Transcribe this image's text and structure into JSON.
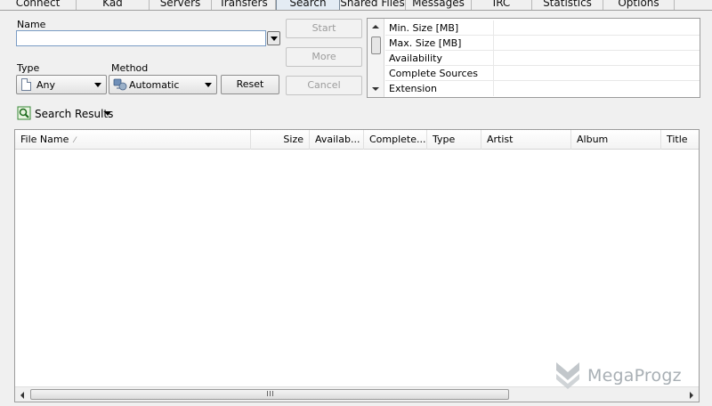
{
  "tabs": [
    {
      "label": "Connect",
      "active": false
    },
    {
      "label": "Kad",
      "active": false
    },
    {
      "label": "Servers",
      "active": false
    },
    {
      "label": "Transfers",
      "active": false
    },
    {
      "label": "Search",
      "active": true
    },
    {
      "label": "Shared Files",
      "active": false
    },
    {
      "label": "Messages",
      "active": false
    },
    {
      "label": "IRC",
      "active": false
    },
    {
      "label": "Statistics",
      "active": false
    },
    {
      "label": "Options",
      "active": false
    }
  ],
  "search": {
    "name_label": "Name",
    "name_value": "",
    "type_label": "Type",
    "type_value": "Any",
    "method_label": "Method",
    "method_value": "Automatic",
    "reset_label": "Reset",
    "start_label": "Start",
    "more_label": "More",
    "cancel_label": "Cancel"
  },
  "filters": [
    {
      "name": "Min. Size [MB]",
      "value": ""
    },
    {
      "name": "Max. Size [MB]",
      "value": ""
    },
    {
      "name": "Availability",
      "value": ""
    },
    {
      "name": "Complete Sources",
      "value": ""
    },
    {
      "name": "Extension",
      "value": ""
    }
  ],
  "results": {
    "label": "Search Results",
    "columns": [
      "File Name",
      "Size",
      "Availab...",
      "Complete...",
      "Type",
      "Artist",
      "Album",
      "Title"
    ],
    "rows": []
  },
  "watermark": {
    "text": "MegaProgz"
  },
  "colors": {
    "accent": "#7a9cc4",
    "active_tab": "#e4ecf4"
  }
}
